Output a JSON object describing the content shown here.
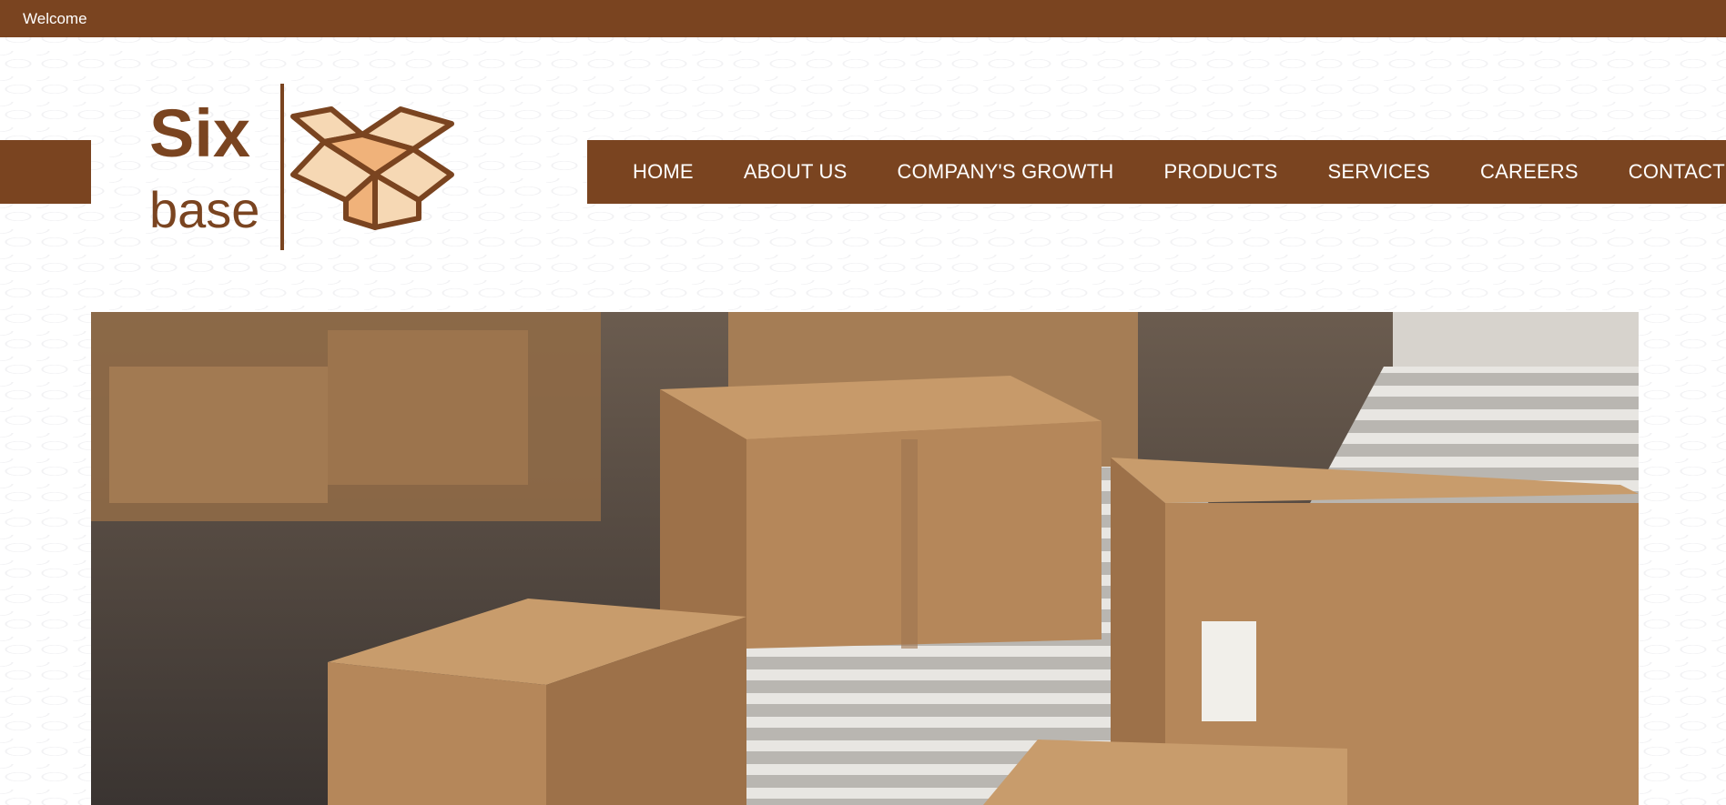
{
  "topbar": {
    "welcome": "Welcome"
  },
  "brand": {
    "line1": "Six",
    "line2": "base",
    "color": "#7a4420"
  },
  "nav": {
    "items": [
      {
        "label": "HOME"
      },
      {
        "label": "ABOUT US"
      },
      {
        "label": "COMPANY'S GROWTH"
      },
      {
        "label": "PRODUCTS"
      },
      {
        "label": "SERVICES"
      },
      {
        "label": "CAREERS"
      },
      {
        "label": "CONTACT US"
      }
    ]
  },
  "hero": {
    "image": "cardboard-boxes-on-conveyor"
  },
  "colors": {
    "primary": "#7a4420",
    "box": "#b5875a",
    "conveyor": "#d8d6d2"
  }
}
